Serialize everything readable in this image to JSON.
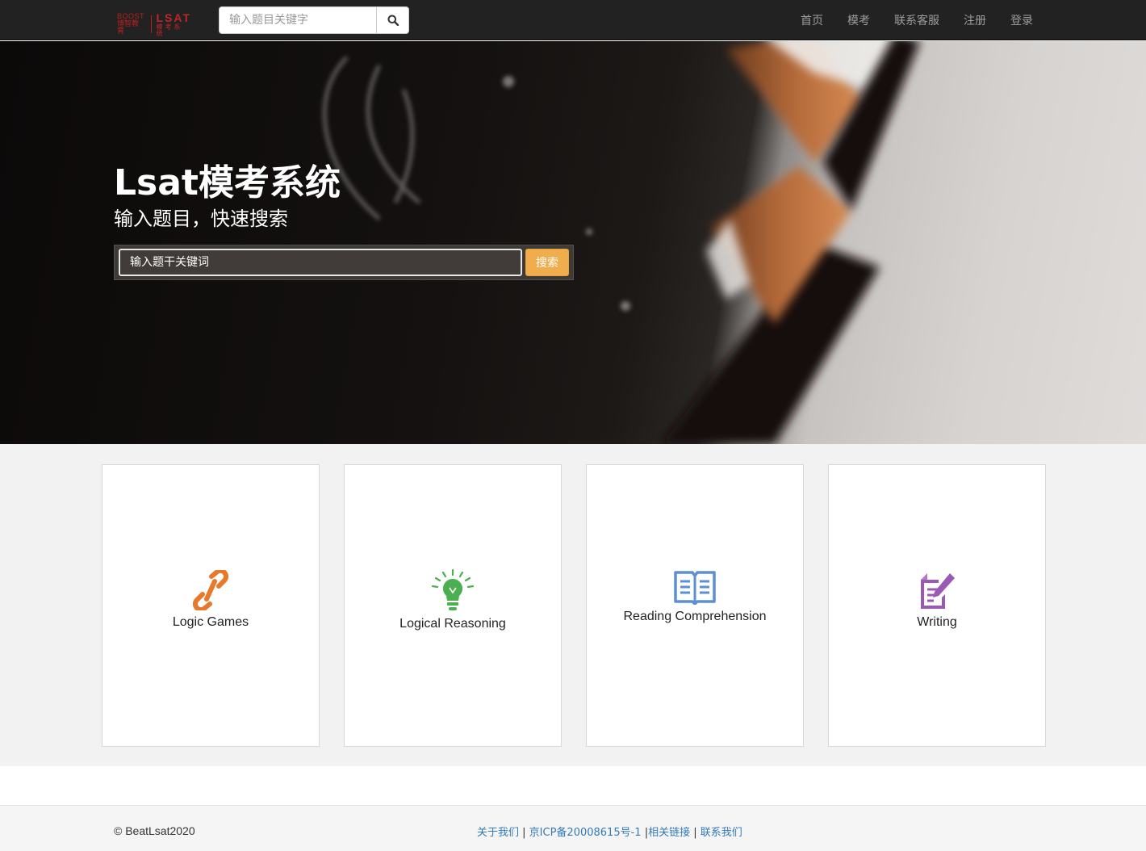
{
  "navbar": {
    "logo": {
      "small_en": "BOOST",
      "small_cn": "博智教育",
      "big_en": "LSAT",
      "big_cn": "模考系统"
    },
    "search_placeholder": "输入题目关键字",
    "search_icon": "search-icon",
    "links": [
      "首页",
      "模考",
      "联系客服",
      "注册",
      "登录"
    ]
  },
  "hero": {
    "title": "Lsat模考系统",
    "subtitle": "输入题目，快速搜索",
    "search_placeholder": "输入题干关键词",
    "search_button": "搜索"
  },
  "cards": [
    {
      "label": "Logic Games",
      "icon": "chain-link-icon",
      "color": "#e8782a"
    },
    {
      "label": "Logical Reasoning",
      "icon": "lightbulb-icon",
      "color": "#4caf50"
    },
    {
      "label": "Reading Comprehension",
      "icon": "open-book-icon",
      "color": "#5b8fd6"
    },
    {
      "label": "Writing",
      "icon": "edit-document-icon",
      "color": "#9b59b6"
    }
  ],
  "footer": {
    "copyright": "© BeatLsat2020",
    "links": [
      "关于我们",
      "京ICP备20008615号-1",
      "相关链接",
      "联系我们"
    ]
  }
}
